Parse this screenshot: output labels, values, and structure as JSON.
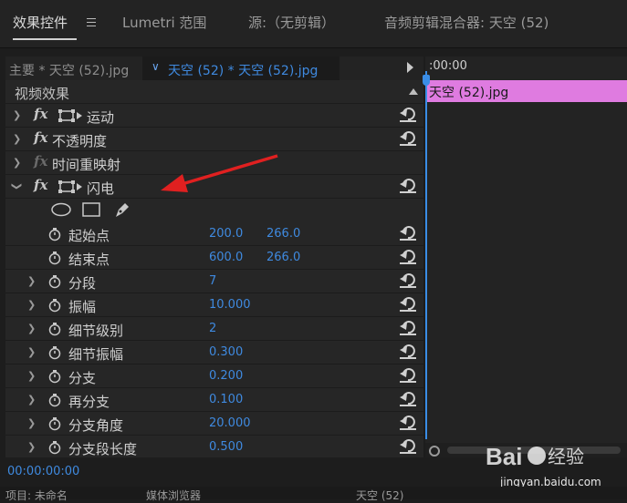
{
  "tabs": [
    {
      "label": "效果控件"
    },
    {
      "label": "Lumetri 范围"
    },
    {
      "label": "源:（无剪辑）"
    },
    {
      "label": "音频剪辑混合器: 天空 (52)"
    }
  ],
  "clip_selector": {
    "master": "主要 * 天空 (52).jpg",
    "sequence": "天空 (52) * 天空 (52).jpg"
  },
  "section_header": "视频效果",
  "effects": [
    {
      "name": "运动"
    },
    {
      "name": "不透明度"
    },
    {
      "name": "时间重映射"
    },
    {
      "name": "闪电"
    }
  ],
  "params": [
    {
      "name": "起始点",
      "v1": "200.0",
      "v2": "266.0"
    },
    {
      "name": "结束点",
      "v1": "600.0",
      "v2": "266.0"
    },
    {
      "name": "分段",
      "v1": "7"
    },
    {
      "name": "振幅",
      "v1": "10.000"
    },
    {
      "name": "细节级别",
      "v1": "2"
    },
    {
      "name": "细节振幅",
      "v1": "0.300"
    },
    {
      "name": "分支",
      "v1": "0.200"
    },
    {
      "name": "再分支",
      "v1": "0.100"
    },
    {
      "name": "分支角度",
      "v1": "20.000"
    },
    {
      "name": "分支段长度",
      "v1": "0.500"
    }
  ],
  "timeline": {
    "time": ":00:00",
    "clip": "天空 (52).jpg"
  },
  "timecode": "00:00:00:00",
  "watermark": {
    "text": "jingyan.baidu.com"
  },
  "bottom_tabs": [
    {
      "label": "项目: 未命名"
    },
    {
      "label": "媒体浏览器"
    },
    {
      "label": "天空 (52)"
    }
  ],
  "colors": {
    "accent": "#3f8ae0",
    "clip": "#df7be0",
    "arrow": "#e02020"
  }
}
